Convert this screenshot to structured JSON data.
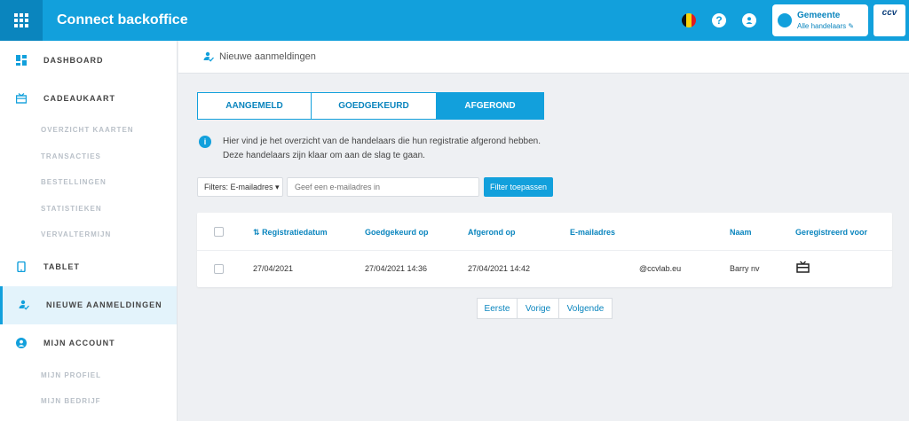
{
  "header": {
    "title": "Connect backoffice",
    "help_icon": "?",
    "gemeente": {
      "name": "Gemeente",
      "sub": "Alle handelaars"
    },
    "logo": "ccv"
  },
  "sidebar": {
    "sections": [
      {
        "label": "DASHBOARD",
        "icon": "dashboard-icon"
      },
      {
        "label": "CADEAUKAART",
        "icon": "giftcard-icon",
        "items": [
          "OVERZICHT KAARTEN",
          "TRANSACTIES",
          "BESTELLINGEN",
          "STATISTIEKEN",
          "VERVALTERMIJN"
        ]
      },
      {
        "label": "TABLET",
        "icon": "tablet-icon"
      },
      {
        "label": "NIEUWE AANMELDINGEN",
        "icon": "user-check-icon",
        "active": true
      },
      {
        "label": "MIJN ACCOUNT",
        "icon": "account-icon",
        "items": [
          "MIJN PROFIEL",
          "MIJN BEDRIJF"
        ]
      }
    ]
  },
  "page": {
    "subheader": "Nieuwe aanmeldingen",
    "tabs": [
      "AANGEMELD",
      "GOEDGEKEURD",
      "AFGEROND"
    ],
    "active_tab": "AFGEROND",
    "info_icon": "i",
    "info_line1": "Hier vind je het overzicht van de handelaars die hun registratie afgerond hebben.",
    "info_line2": "Deze handelaars zijn klaar om aan de slag te gaan.",
    "filter_dropdown": "Filters: E-mailadres ▾",
    "filter_placeholder": "Geef een e-mailadres in",
    "filter_button": "Filter toepassen"
  },
  "table": {
    "columns": [
      "Registratiedatum",
      "Goedgekeurd op",
      "Afgerond op",
      "E-mailadres",
      "Naam",
      "Geregistreerd voor"
    ],
    "rows": [
      {
        "registratiedatum": "27/04/2021",
        "goedgekeurd": "27/04/2021 14:36",
        "afgerond": "27/04/2021 14:42",
        "email": "@ccvlab.eu",
        "naam": "Barry nv",
        "geregistreerd_icon": "giftcard-icon"
      }
    ]
  },
  "pagination": {
    "first": "Eerste",
    "prev": "Vorige",
    "next": "Volgende"
  },
  "colors": {
    "primary": "#12a0dc",
    "primary_dark": "#0a85be"
  }
}
